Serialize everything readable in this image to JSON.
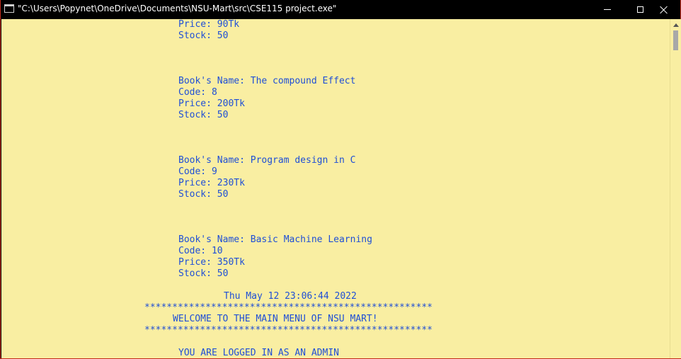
{
  "window": {
    "title": "\"C:\\Users\\Popynet\\OneDrive\\Documents\\NSU-Mart\\src\\CSE115 project.exe\"",
    "controls": {
      "minimize": "minimize",
      "maximize": "maximize",
      "close": "close"
    }
  },
  "colors": {
    "console_bg": "#f9eea2",
    "console_text": "#1f4fd6",
    "titlebar_bg": "#000000"
  },
  "console": {
    "lines": [
      "Price: 90Tk",
      "Stock: 50",
      "Book's Name: The compound Effect",
      "Code: 8",
      "Price: 200Tk",
      "Stock: 50",
      "Book's Name: Program design in C",
      "Code: 9",
      "Price: 230Tk",
      "Stock: 50",
      "Book's Name: Basic Machine Learning",
      "Code: 10",
      "Price: 350Tk",
      "Stock: 50",
      "Thu May 12 23:06:44 2022",
      "****************************************************",
      "WELCOME TO THE MAIN MENU OF NSU MART!",
      "****************************************************",
      "YOU ARE LOGGED IN AS AN ADMIN"
    ]
  }
}
